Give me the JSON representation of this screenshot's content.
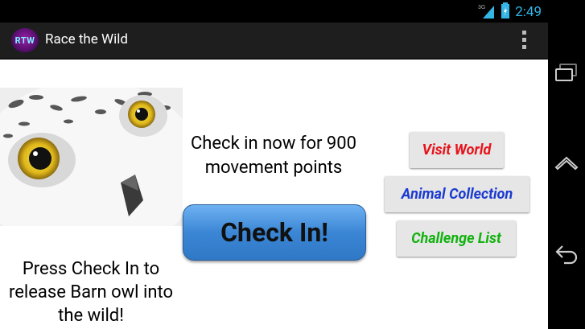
{
  "status_bar": {
    "time": "2:49",
    "signal_label": "3G",
    "colors": {
      "time": "#33b5e5",
      "icons": "#33b5e5"
    }
  },
  "action_bar": {
    "logo_text": "RTW",
    "title": "Race the Wild",
    "menu_icon": "overflow-menu-icon"
  },
  "main": {
    "image_subject": "Barn owl",
    "release_text": "Press Check In to release Barn owl into the wild!",
    "checkin_prompt": "Check in now for 900 movement points",
    "checkin_button_label": "Check In!",
    "nav_buttons": [
      {
        "label": "Visit World",
        "color": "#e8141c"
      },
      {
        "label": "Animal Collection",
        "color": "#1a3ad1"
      },
      {
        "label": "Challenge List",
        "color": "#12b20f"
      }
    ]
  },
  "system_nav": {
    "icons": [
      "recent-apps-icon",
      "home-icon",
      "back-icon"
    ]
  }
}
